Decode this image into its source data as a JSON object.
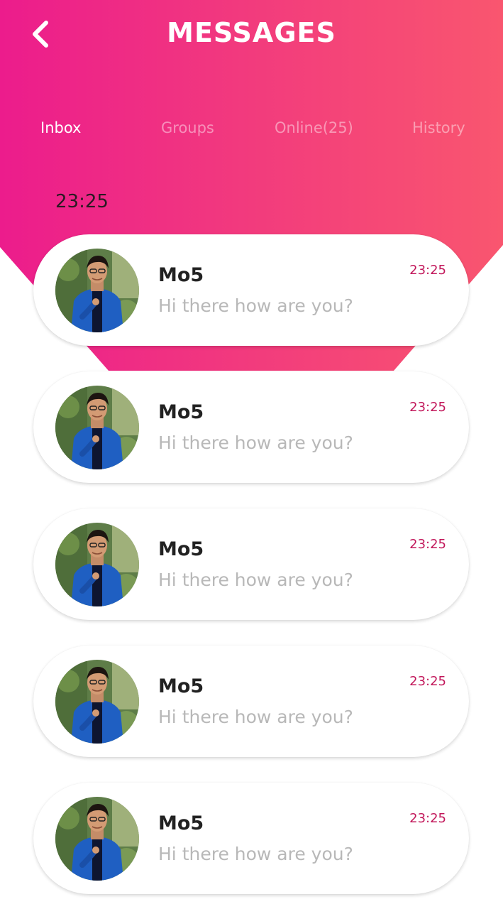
{
  "header": {
    "title": "MESSAGES",
    "back_icon": "chevron-left-icon"
  },
  "tabs": [
    {
      "label": "Inbox",
      "active": true
    },
    {
      "label": "Groups",
      "active": false
    },
    {
      "label": "Online(25)",
      "active": false
    },
    {
      "label": "History",
      "active": false
    }
  ],
  "section_time": "23:25",
  "messages": [
    {
      "name": "Mo5",
      "preview": "Hi there how are you?",
      "time": "23:25"
    },
    {
      "name": "Mo5",
      "preview": "Hi there how are you?",
      "time": "23:25"
    },
    {
      "name": "Mo5",
      "preview": "Hi there how are you?",
      "time": "23:25"
    },
    {
      "name": "Mo5",
      "preview": "Hi there how are you?",
      "time": "23:25"
    },
    {
      "name": "Mo5",
      "preview": "Hi there how are you?",
      "time": "23:25"
    }
  ],
  "colors": {
    "gradient_start": "#ec1c8c",
    "gradient_end": "#f9566f",
    "time_accent": "#c2185b"
  }
}
